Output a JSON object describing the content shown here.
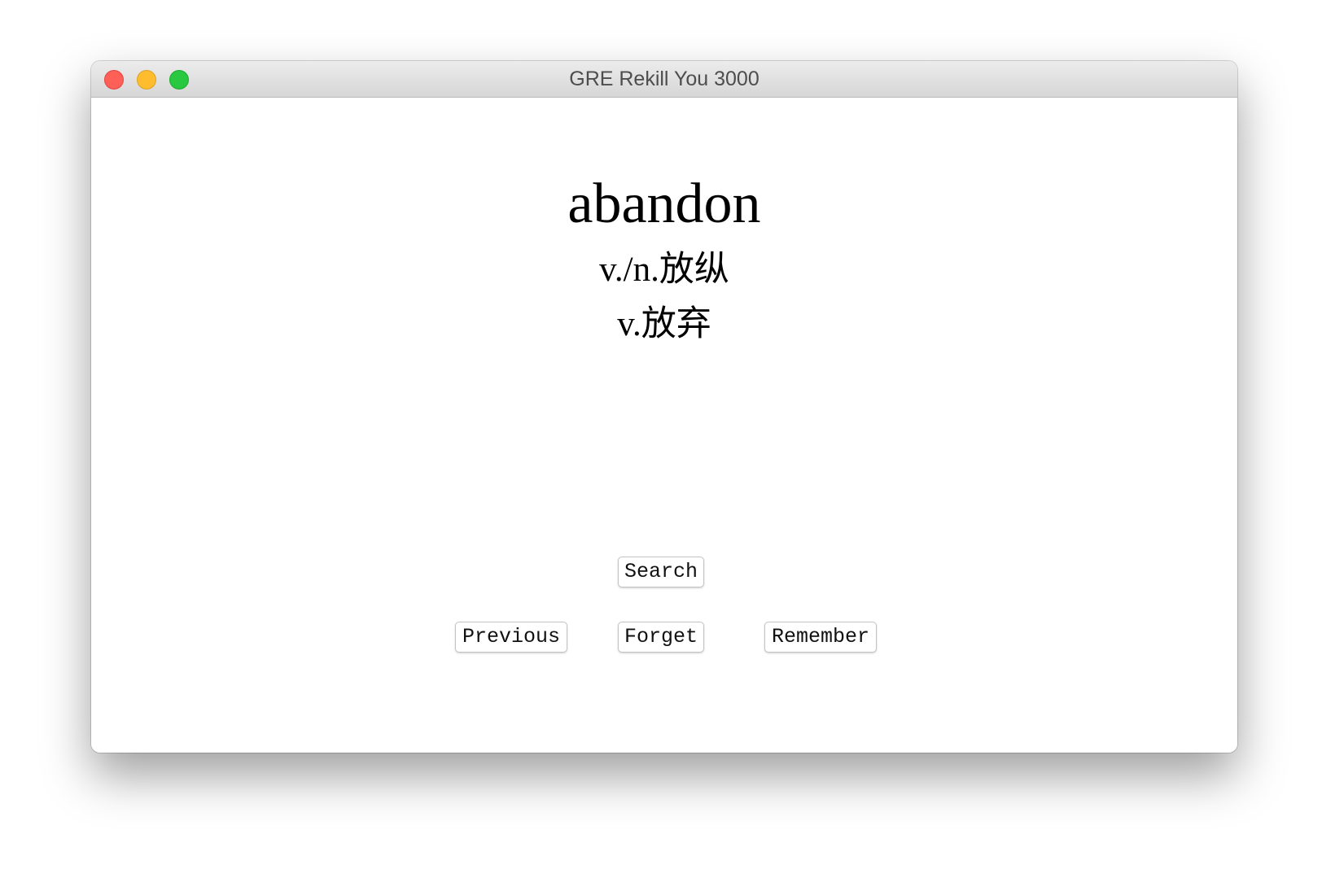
{
  "window": {
    "title": "GRE Rekill You 3000",
    "colors": {
      "close": "#fe5f57",
      "minimize": "#febc2e",
      "maximize": "#28c840"
    }
  },
  "card": {
    "word": "abandon",
    "definitions": [
      "v./n.放纵",
      "v.放弃"
    ]
  },
  "buttons": {
    "search": "Search",
    "previous": "Previous",
    "forget": "Forget",
    "remember": "Remember"
  }
}
